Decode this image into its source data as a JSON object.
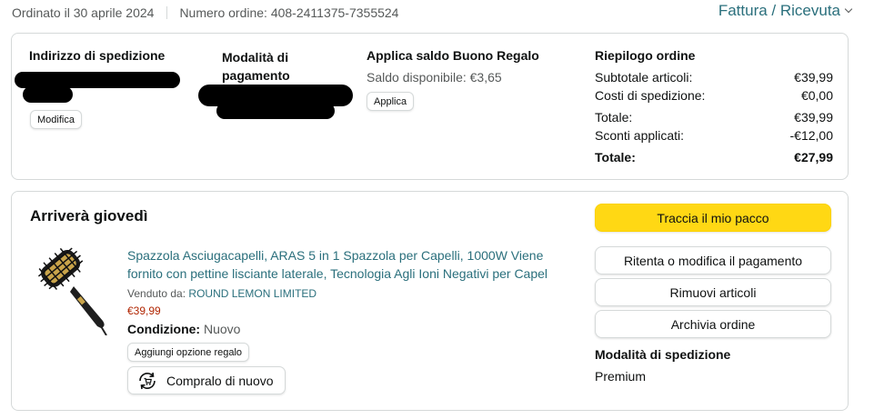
{
  "header": {
    "ordered_on": "Ordinato il 30 aprile 2024",
    "order_number": "Numero ordine: 408-2411375-7355524",
    "invoice_link": "Fattura / Ricevuta"
  },
  "summary": {
    "shipping_address": {
      "heading": "Indirizzo di spedizione",
      "edit_label": "Modifica"
    },
    "payment": {
      "heading": "Modalità di pagamento"
    },
    "gift_card": {
      "heading": "Applica saldo Buono Regalo",
      "balance": "Saldo disponibile: €3,65",
      "apply_label": "Applica"
    },
    "order_summary": {
      "heading": "Riepilogo ordine",
      "rows": [
        {
          "label": "Subtotale articoli:",
          "value": "€39,99"
        },
        {
          "label": "Costi di spedizione:",
          "value": "€0,00"
        },
        {
          "label": "Totale:",
          "value": "€39,99"
        },
        {
          "label": "Sconti applicati:",
          "value": "-€12,00"
        }
      ],
      "grand_total": {
        "label": "Totale:",
        "value": "€27,99"
      }
    }
  },
  "shipment": {
    "arrival": "Arriverà giovedì",
    "product": {
      "title": "Spazzola Asciugacapelli, ARAS 5 in 1 Spazzola per Capelli, 1000W Viene fornito con pettine lisciante laterale, Tecnologia Agli Ioni Negativi per Capel",
      "sold_by_label": "Venduto da:",
      "seller": "ROUND LEMON LIMITED",
      "price": "€39,99",
      "condition_label": "Condizione:",
      "condition_value": "Nuovo",
      "gift_option_label": "Aggiungi opzione regalo",
      "buy_again_label": "Compralo di nuovo",
      "buy_again_icon": "refresh-cart-icon"
    },
    "actions": {
      "track": "Traccia il mio pacco",
      "retry_payment": "Ritenta o modifica il pagamento",
      "remove_items": "Rimuovi articoli",
      "archive": "Archivia ordine"
    },
    "shipping_method": {
      "heading": "Modalità di spedizione",
      "value": "Premium"
    }
  },
  "colors": {
    "link": "#2a6f7c",
    "price": "#b12704",
    "primary_button": "#ffd814",
    "border": "#d5d9d9"
  }
}
